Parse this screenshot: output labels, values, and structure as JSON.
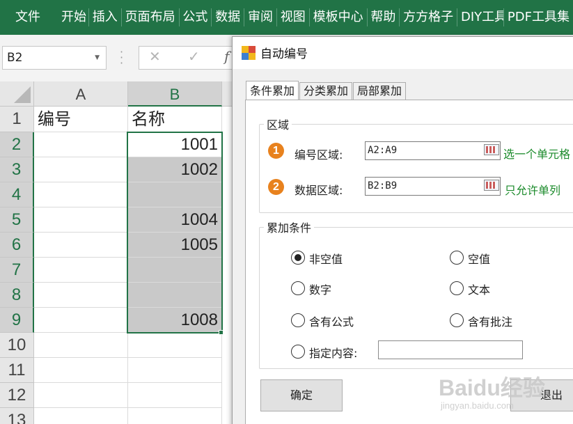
{
  "ribbon": {
    "tabs": [
      "文件",
      "开始",
      "插入",
      "页面布局",
      "公式",
      "数据",
      "审阅",
      "视图",
      "模板中心",
      "帮助",
      "方方格子",
      "DIY工具箱",
      "PDF工具集"
    ]
  },
  "formula_bar": {
    "name_box": "B2",
    "cancel_glyph": "✕",
    "enter_glyph": "✓",
    "fx_glyph": "f"
  },
  "sheet": {
    "columns": [
      "A",
      "B"
    ],
    "rows": [
      "1",
      "2",
      "3",
      "4",
      "5",
      "6",
      "7",
      "8",
      "9",
      "10",
      "11",
      "12",
      "13"
    ],
    "header_row": {
      "a": "编号",
      "b": "名称"
    },
    "b_values": [
      "1001",
      "1002",
      "",
      "1004",
      "1005",
      "",
      "",
      "1008"
    ]
  },
  "dialog": {
    "title": "自动编号",
    "tabs": [
      "条件累加",
      "分类累加",
      "局部累加"
    ],
    "region_group": {
      "legend": "区域",
      "step1_badge": "1",
      "step1_label": "编号区域:",
      "step1_value": "A2:A9",
      "step1_hint": "选一个单元格",
      "step2_badge": "2",
      "step2_label": "数据区域:",
      "step2_value": "B2:B9",
      "step2_hint": "只允许单列"
    },
    "condition_group": {
      "legend": "累加条件",
      "options": [
        "非空值",
        "空值",
        "数字",
        "文本",
        "含有公式",
        "含有批注",
        "指定内容:"
      ],
      "selected": "非空值",
      "custom_value": ""
    },
    "ok_label": "确定",
    "exit_label": "退出"
  },
  "watermark": {
    "brand": "Baidu经验",
    "url": "jingyan.baidu.com"
  },
  "colors": {
    "excel_green": "#217346",
    "badge_orange": "#e8821e",
    "hint_green": "#1a8a2a",
    "selection_gray": "#c9c9c9"
  }
}
